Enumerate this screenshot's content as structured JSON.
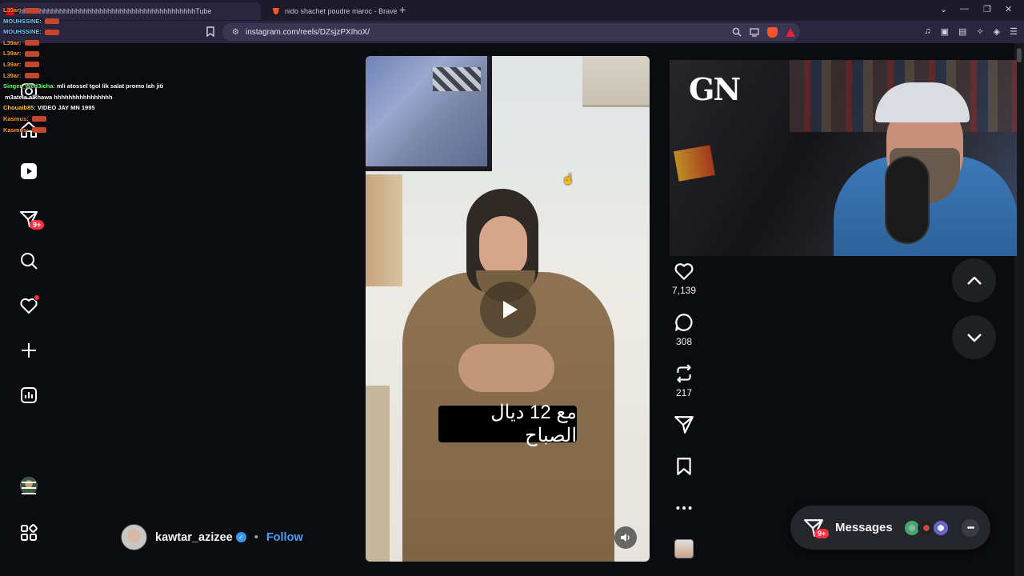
{
  "browser": {
    "tabs": [
      {
        "title": "hhhhhhhhhhhhhhhhhhhhhhhhhhhhhhhhhhhhhhhhhhhhTube",
        "active": true
      },
      {
        "title": "nido shachet poudre maroc - Brave S",
        "active": false
      }
    ],
    "url": "instagram.com/reels/DZsjzPXIhoX/"
  },
  "chat": [
    {
      "user": "L39ar:",
      "text": "",
      "color": "#ff9b2f"
    },
    {
      "user": "MOUHSSINE:",
      "text": "",
      "color": "#6fd1ff"
    },
    {
      "user": "MOUHSSINE:",
      "text": "",
      "color": "#6fd1ff"
    },
    {
      "user": "L39ar:",
      "text": "",
      "color": "#ff9b2f"
    },
    {
      "user": "L39ar:",
      "text": "",
      "color": "#ff9b2f"
    },
    {
      "user": "L39ar:",
      "text": "",
      "color": "#ff9b2f"
    },
    {
      "user": "L39ar:",
      "text": "",
      "color": "#ff9b2f"
    },
    {
      "user": "Singer_Wed3icha:",
      "text": "mli atossel tgol lik salat promo lah jiti",
      "color": "#6cff6c"
    },
    {
      "user": "",
      "text": "m3atela alkhawa hhhhhhhhhhhhhhhh",
      "color": "#ffffff"
    },
    {
      "user": "Chouaib85:",
      "text": "VIDEO JAY MN 1995",
      "color": "#ffcc33"
    },
    {
      "user": "Kasmus:",
      "text": "",
      "color": "#ff9b2f"
    },
    {
      "user": "Kasmus:",
      "text": "",
      "color": "#ff9b2f"
    }
  ],
  "nav": {
    "messages_badge": "9+"
  },
  "reel": {
    "caption": "مع 12 ديال الصباح",
    "author": "kawtar_azizee",
    "separator": "•",
    "follow_label": "Follow"
  },
  "actions": {
    "likes": "7,139",
    "comments": "308",
    "reposts": "217"
  },
  "messages": {
    "label": "Messages",
    "badge": "9+"
  },
  "cam": {
    "logo": "GN"
  }
}
